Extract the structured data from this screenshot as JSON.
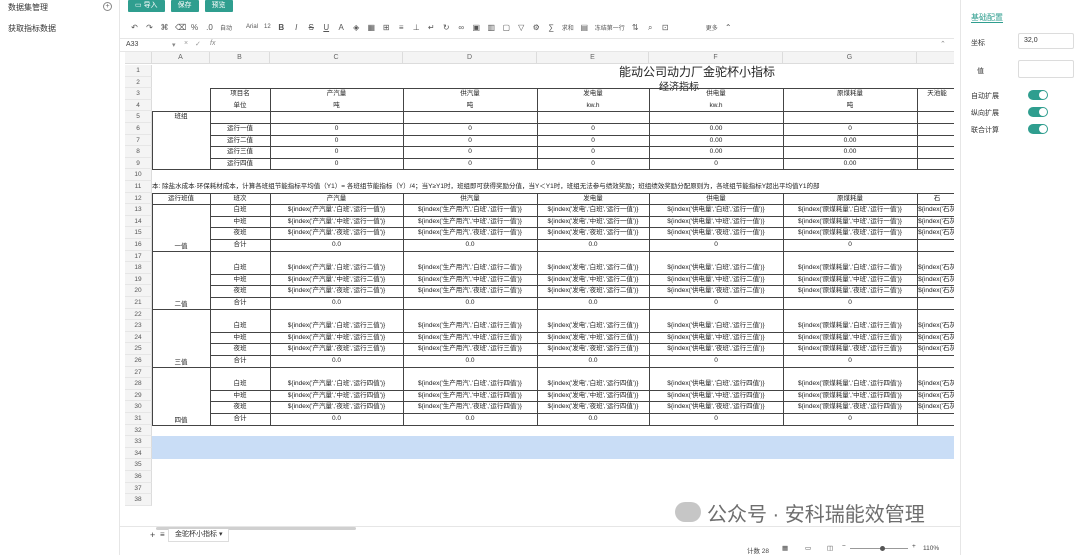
{
  "sidebar": {
    "items": [
      {
        "label": "数据集管理"
      },
      {
        "label": "获取指标数据"
      }
    ]
  },
  "toolbar": {
    "import_label": "导入",
    "save_label": "保存",
    "preview_label": "预览",
    "font_family_value": "Arial",
    "font_size_value": "12",
    "auto_label": "自动",
    "sum_label": "求和",
    "freeze_label": "冻结第一行",
    "more_label": "更多"
  },
  "formula_bar": {
    "cell_ref": "A33",
    "fx": "fx"
  },
  "columns": [
    "A",
    "B",
    "C",
    "D",
    "E",
    "F",
    "G"
  ],
  "rows": [
    "1",
    "2",
    "3",
    "4",
    "5",
    "6",
    "7",
    "8",
    "9",
    "10",
    "11",
    "12",
    "13",
    "14",
    "15",
    "16",
    "17",
    "18",
    "19",
    "20",
    "21",
    "22",
    "23",
    "24",
    "25",
    "26",
    "27",
    "28",
    "29",
    "30",
    "31",
    "32",
    "33",
    "34",
    "35",
    "36",
    "37",
    "38"
  ],
  "sheet": {
    "title": "能动公司动力厂金驼杯小指标",
    "subtitle": "经济指标",
    "header_item": "项目名",
    "header_unit": "单位",
    "team_label": "班组",
    "col_names": [
      "产汽量",
      "供汽量",
      "发电量",
      "供电量",
      "原煤耗量",
      "天池能"
    ],
    "units": [
      "吨",
      "吨",
      "kw.h",
      "kw.h",
      "吨"
    ],
    "shifts": [
      "运行一值",
      "运行二值",
      "运行三值",
      "运行四值"
    ],
    "zero_vals": [
      [
        "0",
        "0",
        "0",
        "0.00",
        "0"
      ],
      [
        "0",
        "0",
        "0",
        "0.00",
        "0.00"
      ],
      [
        "0",
        "0",
        "0",
        "0.00",
        "0.00"
      ],
      [
        "0",
        "0",
        "0",
        "0",
        "0.00"
      ]
    ],
    "note_row": "本: 除盐水成本·环保耗材成本，计算各班组节能指标平均值（Y1）= 各班组节能指标（Y）/4；当Y≥Y1时，班组即可获得奖励分值，当Y＜Y1时，班组无法参与绩效奖励；班组绩效奖励分配原则为，各班组节能指标Y超出平均值Y1的部",
    "sec_header_left": "运行班值",
    "sec_header_b": "班次",
    "sec_cols": [
      "产汽量",
      "供汽量",
      "发电量",
      "供电量",
      "原煤耗量",
      "石"
    ],
    "groups": [
      {
        "name": "一值",
        "key": "运行一值"
      },
      {
        "name": "二值",
        "key": "运行二值"
      },
      {
        "name": "三值",
        "key": "运行三值"
      },
      {
        "name": "四值",
        "key": "运行四值"
      }
    ],
    "shift_names": [
      "白班",
      "中班",
      "夜班"
    ],
    "sum_label": "合计",
    "sum_vals": [
      "0.0",
      "0.0",
      "0.0",
      "0",
      "0"
    ],
    "formula_prefixes": [
      "产汽量",
      "生产用汽",
      "发电",
      "供电量",
      "原煤耗量",
      "石灰"
    ]
  },
  "right_panel": {
    "title": "基础配置",
    "coord_label": "坐标",
    "coord_value": "32,0",
    "value_label": "值",
    "value_value": "",
    "toggles": [
      {
        "label": "自动扩展"
      },
      {
        "label": "纵向扩展"
      },
      {
        "label": "联合计算"
      }
    ]
  },
  "bottom": {
    "sheet_tab": "金驼杯小指标",
    "count_label": "计数 28",
    "zoom": "110%"
  },
  "watermark": {
    "text": "公众号 · 安科瑞能效管理"
  }
}
